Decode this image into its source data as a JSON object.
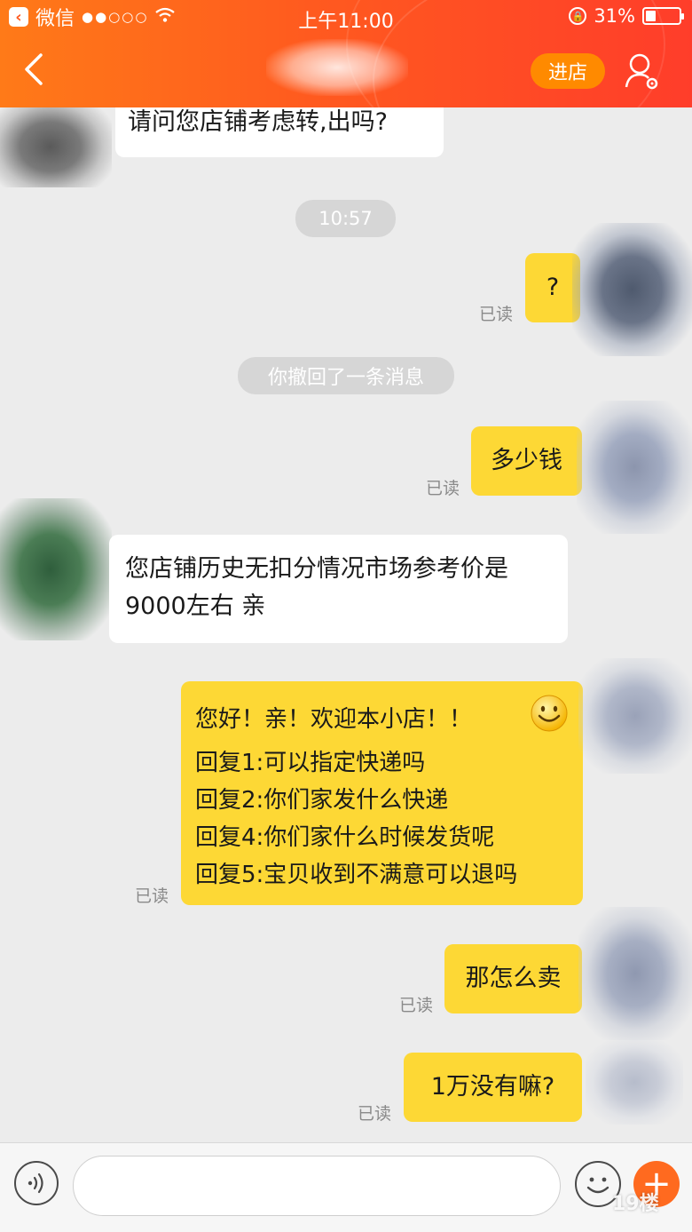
{
  "status_bar": {
    "back_app_label": "微信",
    "time": "上午11:00",
    "battery": "31%",
    "battery_level": 0.31
  },
  "nav": {
    "enter_shop_label": "进店"
  },
  "messages": {
    "m0": "请问您店铺考虑转,出吗?",
    "time1": "10:57",
    "m1": "?",
    "m1_read": "已读",
    "recall": "你撤回了一条消息",
    "m2": "多少钱",
    "m2_read": "已读",
    "m3_line1": "您店铺历史无扣分情况市场参考价是",
    "m3_line2": "9000左右  亲",
    "m4_line1": "您好！亲！欢迎本小店！！",
    "m4_line2": "回复1:可以指定快递吗",
    "m4_line3": "回复2:你们家发什么快递",
    "m4_line4": "回复4:你们家什么时候发货呢",
    "m4_line5": "回复5:宝贝收到不满意可以退吗",
    "m4_read": "已读",
    "m5": "那怎么卖",
    "m5_read": "已读",
    "m6": "1万没有嘛?",
    "m6_read": "已读"
  },
  "input": {
    "value": "",
    "placeholder": ""
  },
  "watermark": "19楼",
  "colors": {
    "header_start": "#ff7a18",
    "header_end": "#ff3d2a",
    "enter_shop_bg": "#ff8a00",
    "outgoing_bubble": "#fdd835",
    "incoming_bubble": "#ffffff",
    "chat_bg": "#ececec",
    "plus_button": "#ff6a1f"
  }
}
